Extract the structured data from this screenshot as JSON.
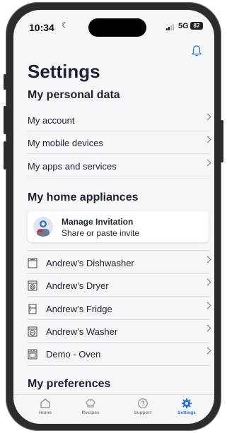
{
  "status_bar": {
    "time": "10:34",
    "network": "5G",
    "battery": "87"
  },
  "page": {
    "title": "Settings"
  },
  "personal": {
    "heading": "My personal data",
    "items": [
      "My account",
      "My mobile devices",
      "My apps and services"
    ]
  },
  "appliances": {
    "heading": "My home appliances",
    "invite": {
      "title": "Manage Invitation",
      "subtitle": "Share or paste invite"
    },
    "items": [
      "Andrew’s Dishwasher",
      "Andrew’s Dryer",
      "Andrew’s Fridge",
      "Andrew’s Washer",
      "Demo - Oven"
    ]
  },
  "preferences": {
    "heading": "My preferences"
  },
  "tabbar": {
    "items": [
      "Home",
      "Recipes",
      "Support",
      "Settings"
    ],
    "active": "Settings",
    "active_color": "#2f6fd6"
  }
}
